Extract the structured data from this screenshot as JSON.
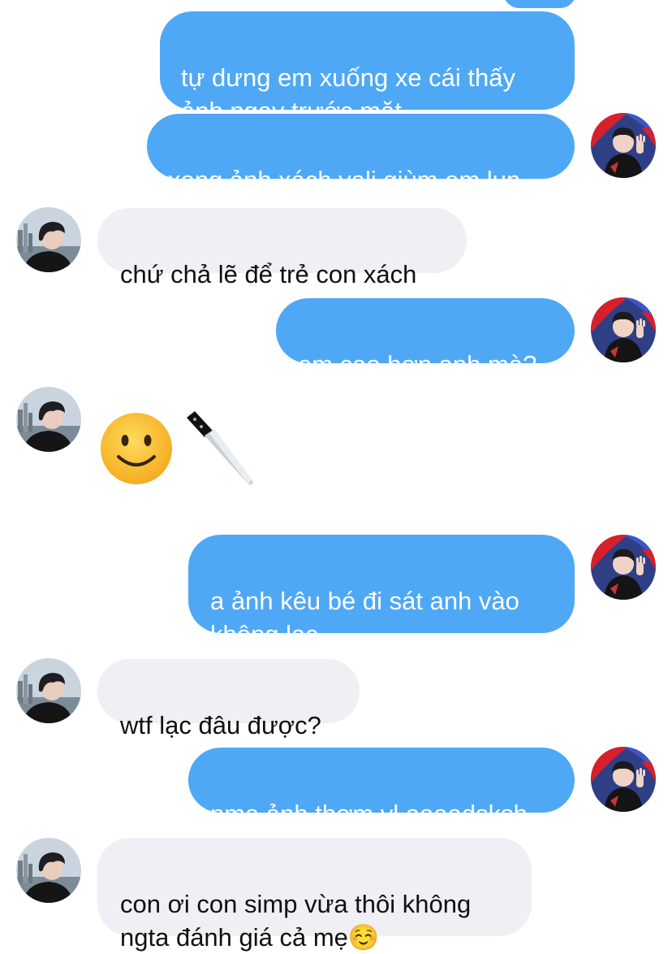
{
  "colors": {
    "sent_bubble": "#4ea8f6",
    "received_bubble": "#efeff4",
    "sent_text": "#ffffff",
    "received_text": "#111111"
  },
  "messages": [
    {
      "from": "me",
      "text": "tự dưng em xuống xe cái thấy\nảnh ngay trước mặt"
    },
    {
      "from": "me",
      "text": "xong ảnh xách vali giùm em lun"
    },
    {
      "from": "them",
      "text": "chứ chả lẽ để trẻ con xách"
    },
    {
      "from": "me",
      "text": "em cao hơn anh mà?"
    },
    {
      "from": "them",
      "emoji": [
        "slightly-smiling-face",
        "kitchen-knife"
      ]
    },
    {
      "from": "me",
      "text": "a ảnh kêu bé đi sát anh vào\nkhông lạc"
    },
    {
      "from": "them",
      "text": "wtf lạc đâu được?"
    },
    {
      "from": "me",
      "text": "nma ảnh thơm vl aaaadsksh"
    },
    {
      "from": "them",
      "text": "con ơi con simp vừa thôi không\nngta đánh giá cả mẹ☺️"
    }
  ]
}
